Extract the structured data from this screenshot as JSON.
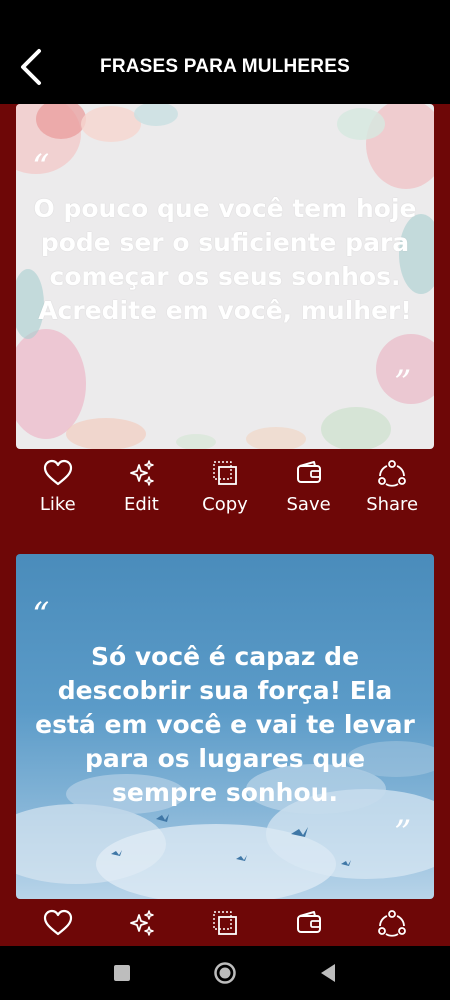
{
  "app_bar": {
    "title": "FRASES PARA MULHERES"
  },
  "cards": [
    {
      "quote": "O pouco que você tem hoje pode ser o suficiente para começar os seus sonhos. Acredite em você, mulher!",
      "open_mark": "“",
      "close_mark": "”"
    },
    {
      "quote": "Só você é capaz de descobrir sua força! Ela está em você e vai te levar para os lugares que sempre sonhou.",
      "open_mark": "“",
      "close_mark": "”"
    }
  ],
  "actions": {
    "like": "Like",
    "edit": "Edit",
    "copy": "Copy",
    "save": "Save",
    "share": "Share"
  },
  "colors": {
    "content_bg": "#6e0707",
    "app_bar_bg": "#000000"
  }
}
